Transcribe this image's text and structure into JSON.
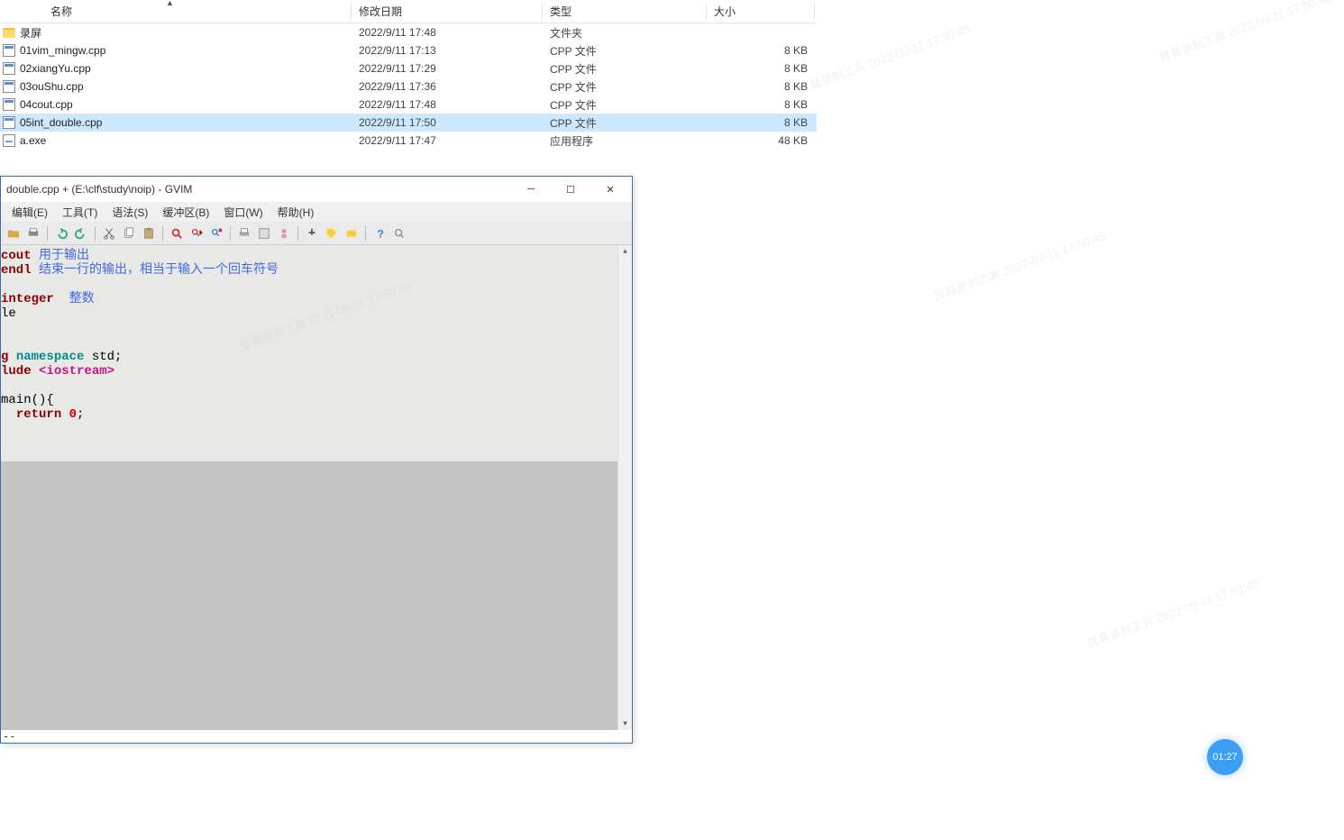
{
  "explorer": {
    "columns": {
      "name": "名称",
      "date": "修改日期",
      "type": "类型",
      "size": "大小"
    },
    "rows": [
      {
        "icon": "folder",
        "name": "录屏",
        "date": "2022/9/11 17:48",
        "type": "文件夹",
        "size": "",
        "selected": false
      },
      {
        "icon": "cpp",
        "name": "01vim_mingw.cpp",
        "date": "2022/9/11 17:13",
        "type": "CPP 文件",
        "size": "8 KB",
        "selected": false
      },
      {
        "icon": "cpp",
        "name": "02xiangYu.cpp",
        "date": "2022/9/11 17:29",
        "type": "CPP 文件",
        "size": "8 KB",
        "selected": false
      },
      {
        "icon": "cpp",
        "name": "03ouShu.cpp",
        "date": "2022/9/11 17:36",
        "type": "CPP 文件",
        "size": "8 KB",
        "selected": false
      },
      {
        "icon": "cpp",
        "name": "04cout.cpp",
        "date": "2022/9/11 17:48",
        "type": "CPP 文件",
        "size": "8 KB",
        "selected": false
      },
      {
        "icon": "cpp",
        "name": "05int_double.cpp",
        "date": "2022/9/11 17:50",
        "type": "CPP 文件",
        "size": "8 KB",
        "selected": true
      },
      {
        "icon": "exe",
        "name": "a.exe",
        "date": "2022/9/11 17:47",
        "type": "应用程序",
        "size": "48 KB",
        "selected": false
      }
    ]
  },
  "gvim": {
    "title": "double.cpp + (E:\\clf\\study\\noip) - GVIM",
    "menus": [
      "编辑(E)",
      "工具(T)",
      "语法(S)",
      "缓冲区(B)",
      "窗口(W)",
      "帮助(H)"
    ],
    "status": "--",
    "code": {
      "l1a": "cout",
      "l1b": " 用于输出",
      "l2a": "endl",
      "l2b": " 结束一行的输出，相当于输入一个回车符号",
      "l3": "",
      "l4a": "integer",
      "l4b": "  整数",
      "l5": "le",
      "l6": "",
      "l7": "",
      "l8a": "g ",
      "l8b": "namespace",
      "l8c": " std;",
      "l9a": "lude ",
      "l9b": "<iostream>",
      "l10": "",
      "l11": "main(){",
      "l12a": "  ",
      "l12b": "return",
      "l12c": " ",
      "l12d": "0",
      "l12e": ";"
    }
  },
  "time_badge": "01:27",
  "watermark": "屏幕录制工具 2022-09-11 17:50:45"
}
